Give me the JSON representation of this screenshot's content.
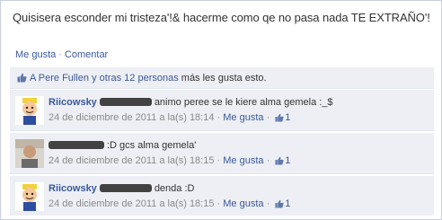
{
  "post": {
    "text": "Quisisera esconder mi tristeza'!& hacerme como qe no pasa nada TE EXTRAÑO'!"
  },
  "actions": {
    "like": "Me gusta",
    "separator": "·",
    "comment": "Comentar"
  },
  "likes": {
    "icon": "thumbs-up-icon",
    "names": "A Pere Fullen y otras 12 personas",
    "suffix": "más les gusta esto."
  },
  "comments": [
    {
      "author": "Riicowsky",
      "text": "animo peree se le kiere alma gemela :_$",
      "timestamp": "24 de diciembre de 2011 a la(s) 18:14",
      "like_label": "Me gusta",
      "like_count": "1",
      "avatar": "cartoon-avatar"
    },
    {
      "author": "",
      "text": ":D gcs alma gemela'",
      "timestamp": "24 de diciembre de 2011 a la(s) 18:15",
      "like_label": "Me gusta",
      "like_count": "1",
      "avatar": "photo-avatar"
    },
    {
      "author": "Riicowsky",
      "text": "denda :D",
      "timestamp": "24 de diciembre de 2011 a la(s) 18:15",
      "like_label": "Me gusta",
      "like_count": "1",
      "avatar": "cartoon-avatar"
    }
  ],
  "colors": {
    "link": "#3b5998",
    "ufi_background": "#edeff4",
    "meta_text": "#8a8a8a"
  }
}
